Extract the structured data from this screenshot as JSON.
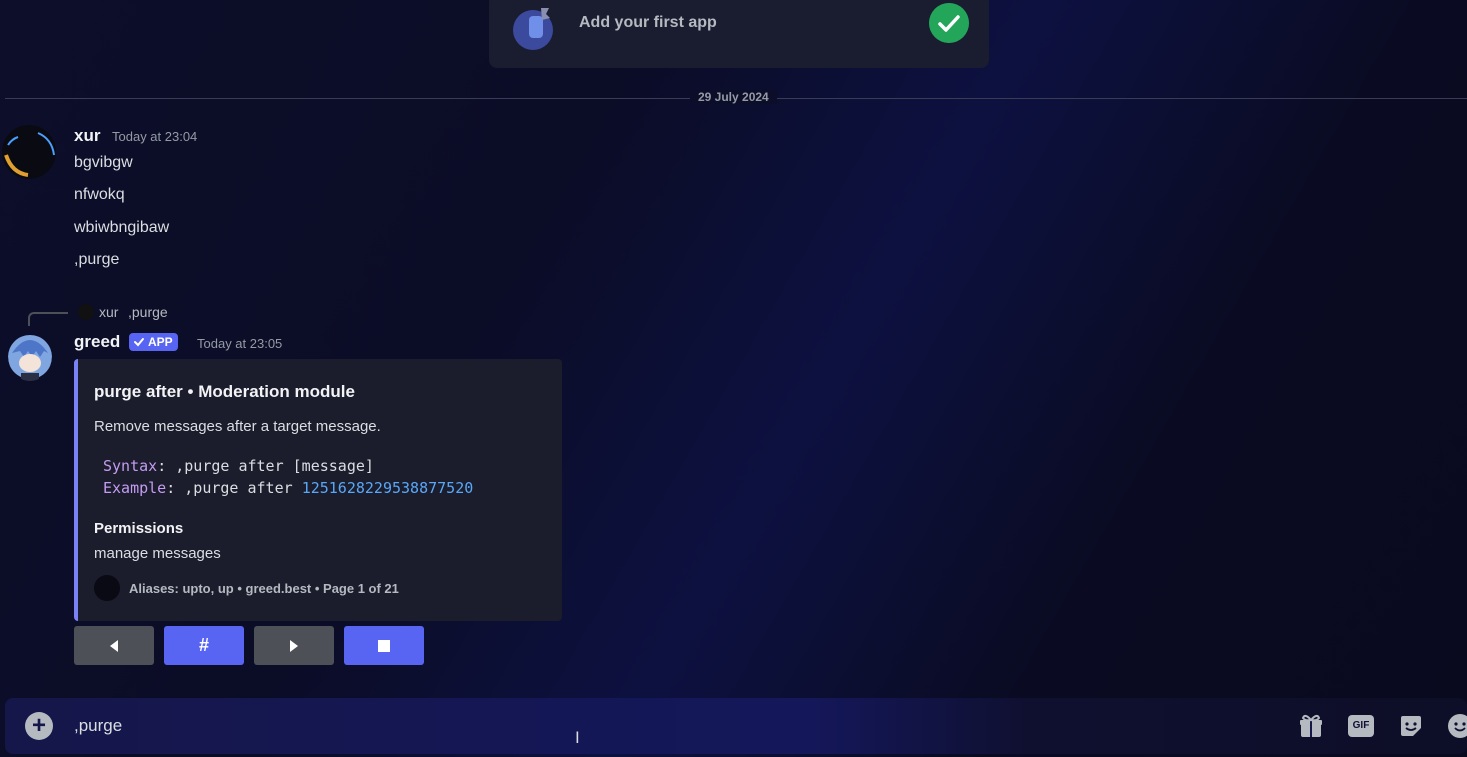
{
  "onboarding": {
    "title": "Add your first app"
  },
  "divider": {
    "date": "29 July 2024"
  },
  "messages": [
    {
      "user": "xur",
      "time": "Today at 23:04",
      "lines": [
        "bgvibgw",
        "nfwokq",
        "wbiwbngibaw",
        ",purge"
      ]
    }
  ],
  "reply": {
    "user": "xur",
    "text": ",purge"
  },
  "bot": {
    "user": "greed",
    "badge": "APP",
    "time": "Today at 23:05",
    "embed": {
      "title": "purge after • Moderation module",
      "description": "Remove messages after a target message.",
      "syntax_label": "Syntax",
      "syntax_value": ",purge after [message]",
      "example_label": "Example",
      "example_cmd": ",purge after ",
      "example_id": "1251628229538877520",
      "field_name": "Permissions",
      "field_value": "manage messages",
      "footer": "Aliases: upto, up • greed.best • Page 1 of 21",
      "accent": "#7983f5"
    },
    "buttons": [
      {
        "icon": "arrow-left-icon",
        "label": "◀",
        "style": "grey"
      },
      {
        "icon": "hash-icon",
        "label": "#",
        "style": "blurple"
      },
      {
        "icon": "arrow-right-icon",
        "label": "▶",
        "style": "grey"
      },
      {
        "icon": "stop-icon",
        "label": "■",
        "style": "blurple"
      }
    ]
  },
  "composer": {
    "value": ",purge",
    "icons": [
      "gift-icon",
      "gif-icon",
      "sticker-icon",
      "emoji-icon"
    ],
    "gif_label": "GIF"
  },
  "colors": {
    "blurple": "#5865f2",
    "green": "#23a55a",
    "grey_button": "#4e5058"
  }
}
